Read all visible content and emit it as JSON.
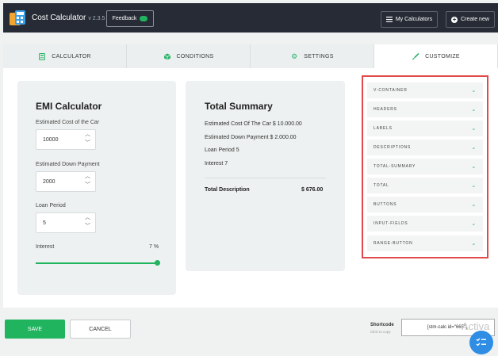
{
  "header": {
    "app_title": "Cost Calculator",
    "version": "v 2.3.5",
    "feedback_label": "Feedback",
    "my_calculators_label": "My Calculators",
    "create_new_label": "Create new"
  },
  "tabs": [
    {
      "label": "CALCULATOR",
      "icon": "calculator-icon",
      "active": false
    },
    {
      "label": "CONDITIONS",
      "icon": "cube-icon",
      "active": false
    },
    {
      "label": "SETTINGS",
      "icon": "gear-icon",
      "active": false
    },
    {
      "label": "CUSTOMIZE",
      "icon": "brush-icon",
      "active": true
    }
  ],
  "calculator": {
    "title": "EMI Calculator",
    "fields": [
      {
        "label": "Estimated Cost of the Car",
        "value": "10000"
      },
      {
        "label": "Estimated Down Payment",
        "value": "2000"
      },
      {
        "label": "Loan Period",
        "value": "5"
      }
    ],
    "interest_label": "Interest",
    "interest_value": "7 %",
    "interest_level": 7
  },
  "summary": {
    "title": "Total Summary",
    "lines": [
      "Estimated Cost Of The Car $ 10.000.00",
      "Estimated Down Payment $ 2.000.00",
      "Loan Period 5",
      "Interest 7"
    ],
    "total_label": "Total Description",
    "total_value": "$ 676.00"
  },
  "customize_items": [
    "V-CONTAINER",
    "HEADERS",
    "LABELS",
    "DESCRIPTIONS",
    "TOTAL-SUMMARY",
    "TOTAL",
    "BUTTONS",
    "INPUT-FIELDS",
    "RANGE-BUTTON"
  ],
  "footer": {
    "save_label": "SAVE",
    "cancel_label": "CANCEL",
    "shortcode_label": "Shortcode",
    "shortcode_hint": "Click to copy",
    "shortcode_value": "[stm-calc id=\"665\"]",
    "watermark": "Activa"
  },
  "colors": {
    "accent": "#21b45f",
    "header_bg": "#262b35",
    "highlight_border": "#e04a4a",
    "fab": "#2f8de4"
  }
}
